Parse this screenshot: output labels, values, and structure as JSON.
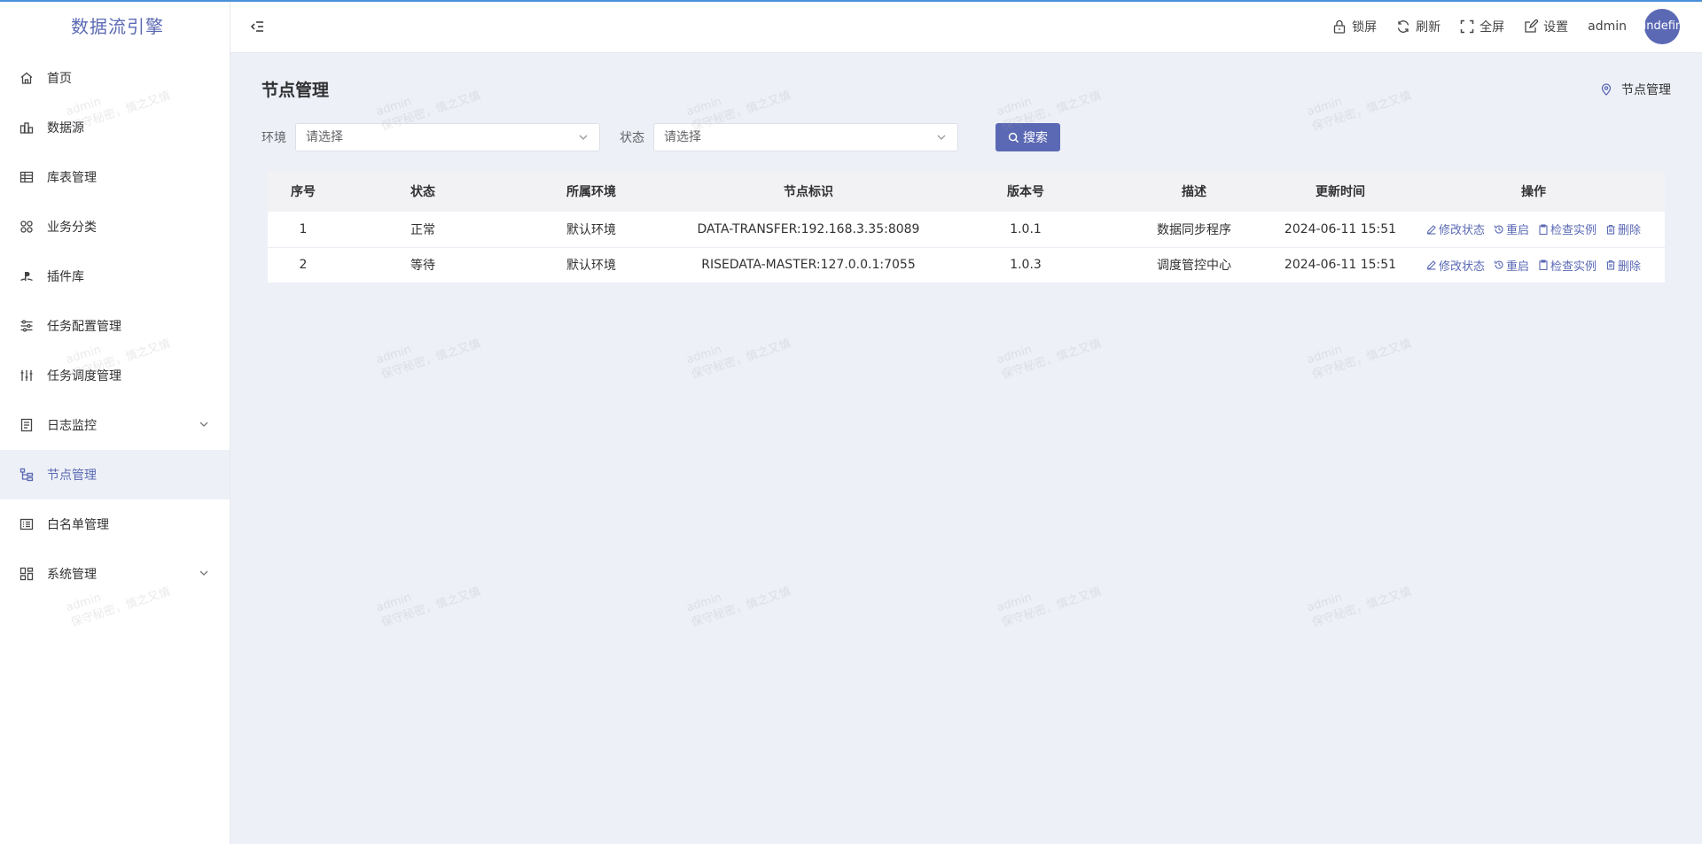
{
  "app": {
    "title": "数据流引擎"
  },
  "sidebar": {
    "items": [
      {
        "label": "首页",
        "icon": "home-icon"
      },
      {
        "label": "数据源",
        "icon": "database-icon"
      },
      {
        "label": "库表管理",
        "icon": "table-icon"
      },
      {
        "label": "业务分类",
        "icon": "category-icon"
      },
      {
        "label": "插件库",
        "icon": "plugin-icon"
      },
      {
        "label": "任务配置管理",
        "icon": "sliders-icon"
      },
      {
        "label": "任务调度管理",
        "icon": "schedule-icon"
      },
      {
        "label": "日志监控",
        "icon": "log-icon",
        "expandable": true
      },
      {
        "label": "节点管理",
        "icon": "node-tree-icon",
        "active": true
      },
      {
        "label": "白名单管理",
        "icon": "list-icon"
      },
      {
        "label": "系统管理",
        "icon": "dashboard-icon",
        "expandable": true
      }
    ]
  },
  "header": {
    "lock": "锁屏",
    "refresh": "刷新",
    "fullscreen": "全屏",
    "settings": "设置",
    "user": "admin",
    "avatar_text": "undefined"
  },
  "page": {
    "title": "节点管理",
    "breadcrumb": "节点管理"
  },
  "filter": {
    "env_label": "环境",
    "env_placeholder": "请选择",
    "status_label": "状态",
    "status_placeholder": "请选择",
    "search_label": "搜索"
  },
  "table": {
    "columns": [
      "序号",
      "状态",
      "所属环境",
      "节点标识",
      "版本号",
      "描述",
      "更新时间",
      "操作"
    ],
    "rows": [
      {
        "index": "1",
        "status": "正常",
        "env": "默认环境",
        "node": "DATA-TRANSFER:192.168.3.35:8089",
        "version": "1.0.1",
        "desc": "数据同步程序",
        "updated": "2024-06-11 15:51"
      },
      {
        "index": "2",
        "status": "等待",
        "env": "默认环境",
        "node": "RISEDATA-MASTER:127.0.0.1:7055",
        "version": "1.0.3",
        "desc": "调度管控中心",
        "updated": "2024-06-11 15:51"
      }
    ],
    "actions": {
      "modify": "修改状态",
      "restart": "重启",
      "inspect": "检查实例",
      "delete": "删除"
    }
  },
  "watermark": {
    "line1": "admin",
    "line2": "保守秘密，慎之又慎"
  },
  "colors": {
    "accent": "#5b69b4",
    "background": "#edf0f6"
  }
}
